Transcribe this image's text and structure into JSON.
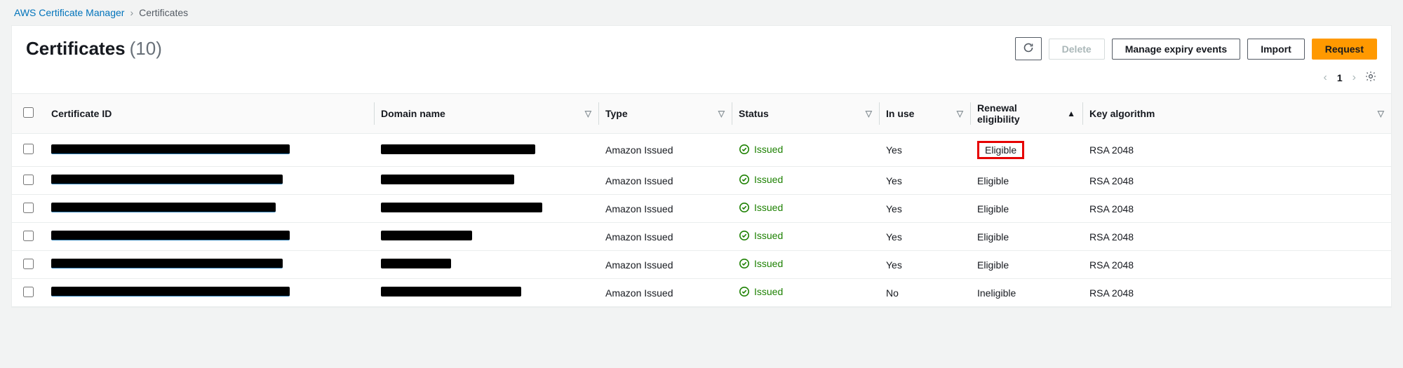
{
  "breadcrumb": {
    "root": "AWS Certificate Manager",
    "current": "Certificates"
  },
  "header": {
    "title": "Certificates",
    "count": "(10)"
  },
  "actions": {
    "refresh_aria": "Refresh",
    "delete": "Delete",
    "manage": "Manage expiry events",
    "import": "Import",
    "request": "Request"
  },
  "pager": {
    "page": "1"
  },
  "columns": {
    "cert_id": "Certificate ID",
    "domain": "Domain name",
    "type": "Type",
    "status": "Status",
    "in_use": "In use",
    "renewal_line1": "Renewal",
    "renewal_line2": "eligibility",
    "key_alg": "Key algorithm"
  },
  "status_label": "Issued",
  "rows": [
    {
      "id_w": 340,
      "domain_w": 220,
      "type": "Amazon Issued",
      "status": "Issued",
      "in_use": "Yes",
      "renewal": "Eligible",
      "alg": "RSA 2048",
      "highlight": true
    },
    {
      "id_w": 330,
      "domain_w": 190,
      "type": "Amazon Issued",
      "status": "Issued",
      "in_use": "Yes",
      "renewal": "Eligible",
      "alg": "RSA 2048",
      "highlight": false
    },
    {
      "id_w": 320,
      "domain_w": 230,
      "type": "Amazon Issued",
      "status": "Issued",
      "in_use": "Yes",
      "renewal": "Eligible",
      "alg": "RSA 2048",
      "highlight": false
    },
    {
      "id_w": 340,
      "domain_w": 130,
      "type": "Amazon Issued",
      "status": "Issued",
      "in_use": "Yes",
      "renewal": "Eligible",
      "alg": "RSA 2048",
      "highlight": false
    },
    {
      "id_w": 330,
      "domain_w": 100,
      "type": "Amazon Issued",
      "status": "Issued",
      "in_use": "Yes",
      "renewal": "Eligible",
      "alg": "RSA 2048",
      "highlight": false
    },
    {
      "id_w": 340,
      "domain_w": 200,
      "type": "Amazon Issued",
      "status": "Issued",
      "in_use": "No",
      "renewal": "Ineligible",
      "alg": "RSA 2048",
      "highlight": false
    }
  ]
}
